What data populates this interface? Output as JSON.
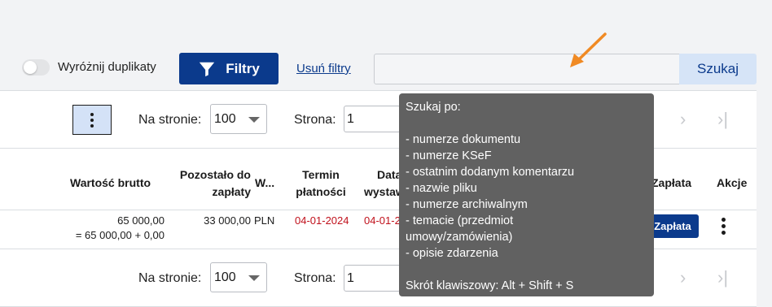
{
  "toolbar": {
    "toggle_label": "Wyróżnij duplikaty",
    "filters_label": "Filtry",
    "clear_filters_label": "Usuń filtry",
    "search_value": "",
    "search_button_label": "Szukaj"
  },
  "pagination": {
    "per_page_label": "Na stronie:",
    "per_page_value": "100",
    "page_label": "Strona:",
    "page_value": "1"
  },
  "table": {
    "headers": {
      "gross": "Wartość brutto",
      "remaining_1": "Pozostało do",
      "remaining_2": "zapłaty",
      "currency": "W...",
      "due_1": "Termin",
      "due_2": "płatności",
      "issue_1": "Data",
      "issue_2": "wystaw",
      "payment": "Zapłata",
      "actions": "Akcje"
    },
    "rows": [
      {
        "gross": "65 000,00",
        "gross_formula": "= 65 000,00 + 0,00",
        "remaining": "33 000,00",
        "currency": "PLN",
        "due_date": "04-01-2024",
        "issue_date": "04-01-2",
        "payment_button": "Zapłata"
      }
    ]
  },
  "tooltip": {
    "title": "Szukaj po:",
    "items": [
      "- numerze dokumentu",
      "- numerze KSeF",
      "- ostatnim dodanym komentarzu",
      "- nazwie pliku",
      "- numerze archiwalnym",
      "- temacie (przedmiot",
      "umowy/zamówienia)",
      "- opisie zdarzenia"
    ],
    "shortcut": "Skrót klawiszowy: Alt + Shift + S"
  },
  "colors": {
    "primary": "#0b3a8c",
    "search_button_bg": "#d6e4f7",
    "tooltip_bg": "#616161",
    "date_red": "#c0111c",
    "arrow": "#f08a24"
  },
  "icons": [
    "filter-icon",
    "more-vert-icon",
    "next-page-icon",
    "last-page-icon",
    "arrow-pointer-icon"
  ]
}
